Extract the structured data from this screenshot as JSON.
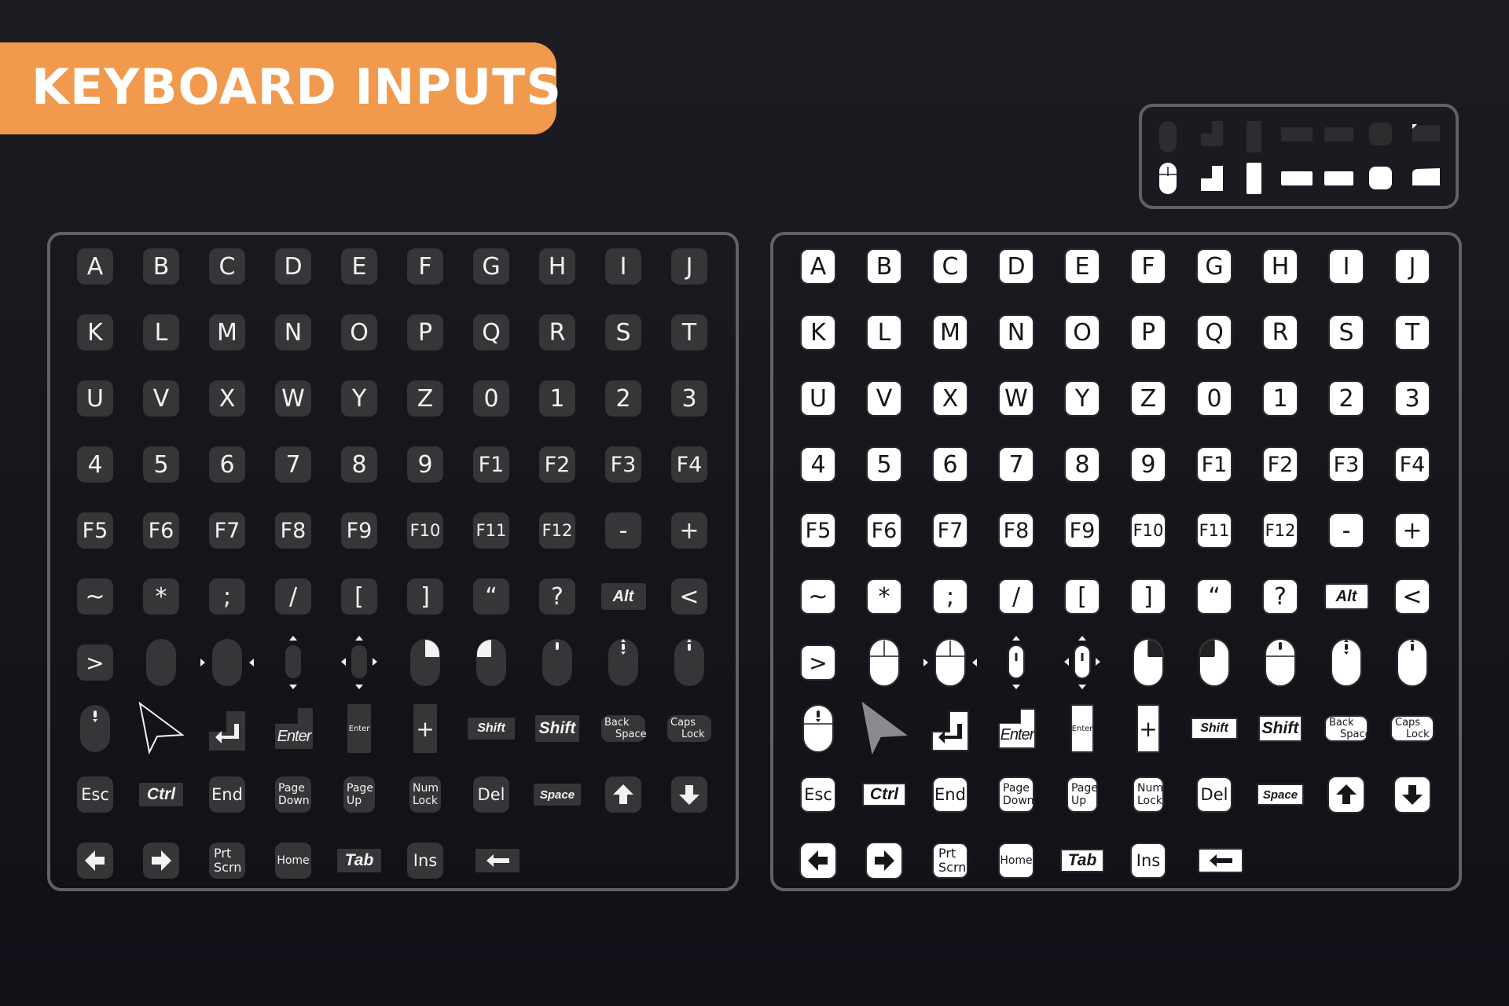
{
  "header": {
    "title": "KEYBOARD INPUTS"
  },
  "colors": {
    "accent": "#f19a4d",
    "key_dark": "#363639",
    "key_light": "#ffffff",
    "panel_border": "#616168"
  },
  "rows": [
    [
      "A",
      "B",
      "C",
      "D",
      "E",
      "F",
      "G",
      "H",
      "I",
      "J"
    ],
    [
      "K",
      "L",
      "M",
      "N",
      "O",
      "P",
      "Q",
      "R",
      "S",
      "T"
    ],
    [
      "U",
      "V",
      "X",
      "W",
      "Y",
      "Z",
      "0",
      "1",
      "2",
      "3"
    ],
    [
      "4",
      "5",
      "6",
      "7",
      "8",
      "9",
      "F1",
      "F2",
      "F3",
      "F4"
    ],
    [
      "F5",
      "F6",
      "F7",
      "F8",
      "F9",
      "F10",
      "F11",
      "F12",
      "-",
      "+"
    ],
    [
      "~",
      "*",
      ";",
      "/",
      "[",
      "]",
      "“",
      "?",
      "Alt",
      "<"
    ]
  ],
  "row7": {
    "gt": ">"
  },
  "row8": {
    "plus": "+",
    "enter": "Enter",
    "enter_small": "Enter",
    "shift_small": "Shift",
    "shift": "Shift",
    "backspace_1": "Back",
    "backspace_2": "Space",
    "capslock_1": "Caps",
    "capslock_2": "Lock"
  },
  "row9": {
    "esc": "Esc",
    "ctrl": "Ctrl",
    "end": "End",
    "pagedown_1": "Page",
    "pagedown_2": "Down",
    "pageup_1": "Page",
    "pageup_2": "Up",
    "numlock_1": "Num",
    "numlock_2": "Lock",
    "del": "Del",
    "space": "Space"
  },
  "row10": {
    "prtscrn_1": "Prt",
    "prtscrn_2": "Scrn",
    "home": "Home",
    "tab": "Tab",
    "ins": "Ins"
  },
  "legend": {
    "shapes": [
      "mouse-shape",
      "corner-shape",
      "tall-shape",
      "wide-shape",
      "wide-shape",
      "square-shape",
      "slant-shape"
    ]
  }
}
